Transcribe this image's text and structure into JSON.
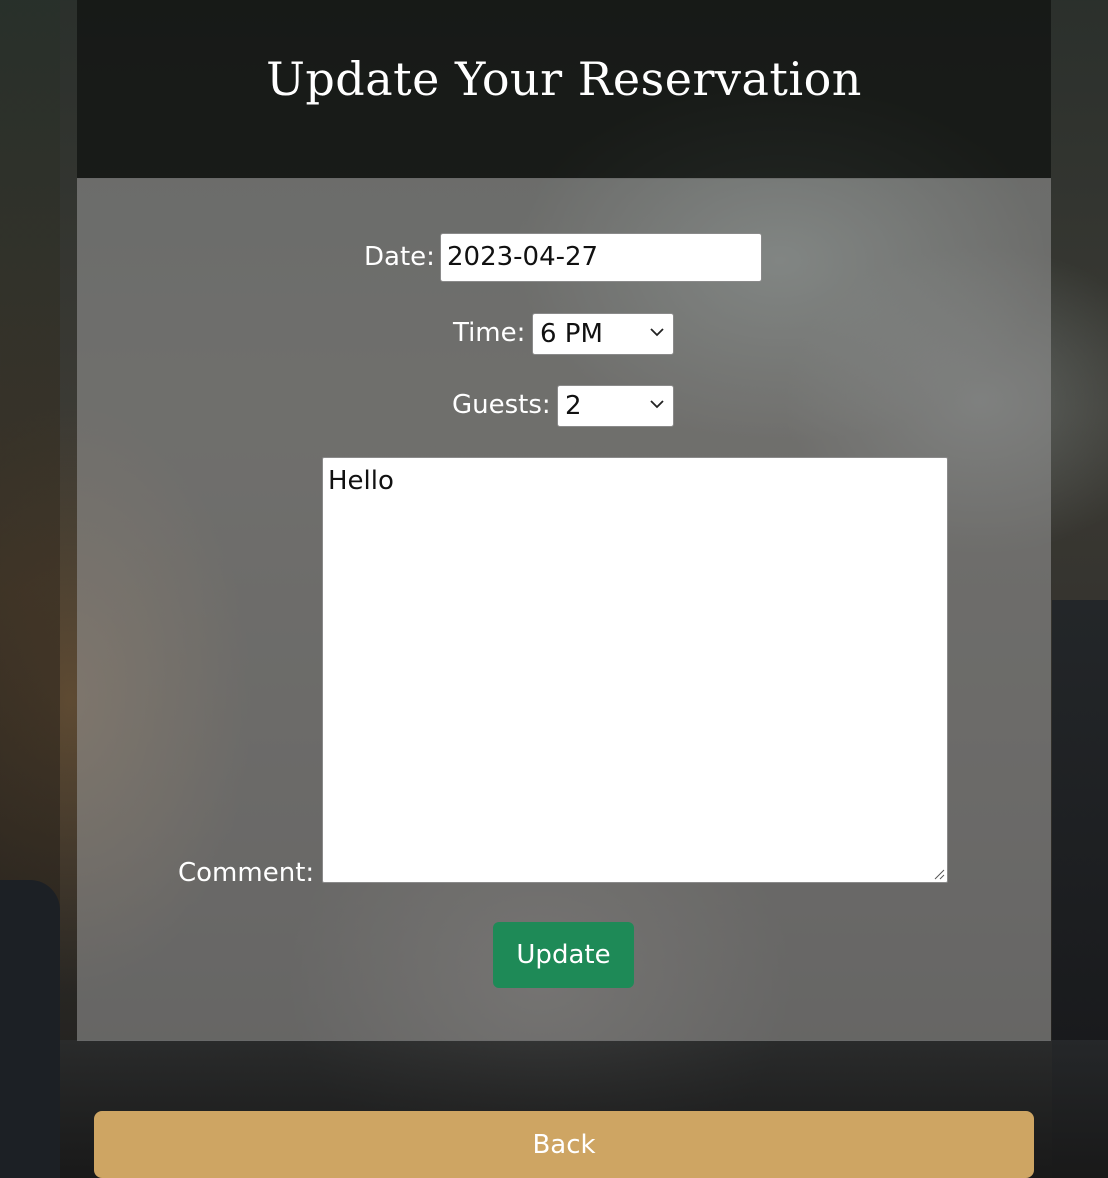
{
  "header": {
    "title": "Update Your Reservation"
  },
  "form": {
    "date": {
      "label": "Date:",
      "value": "2023-04-27"
    },
    "time": {
      "label": "Time:",
      "selected": "6 PM"
    },
    "guests": {
      "label": "Guests:",
      "selected": "2"
    },
    "comment": {
      "label": "Comment:",
      "value": "Hello"
    },
    "update_label": "Update"
  },
  "footer": {
    "back_label": "Back"
  },
  "colors": {
    "update_button": "#1e8a57",
    "back_button": "#cea563",
    "header_bg": "#121412",
    "body_panel": "#969696"
  },
  "icons": {
    "select_arrow": "chevron-down-icon",
    "textarea_resize": "resize-handle-icon"
  }
}
